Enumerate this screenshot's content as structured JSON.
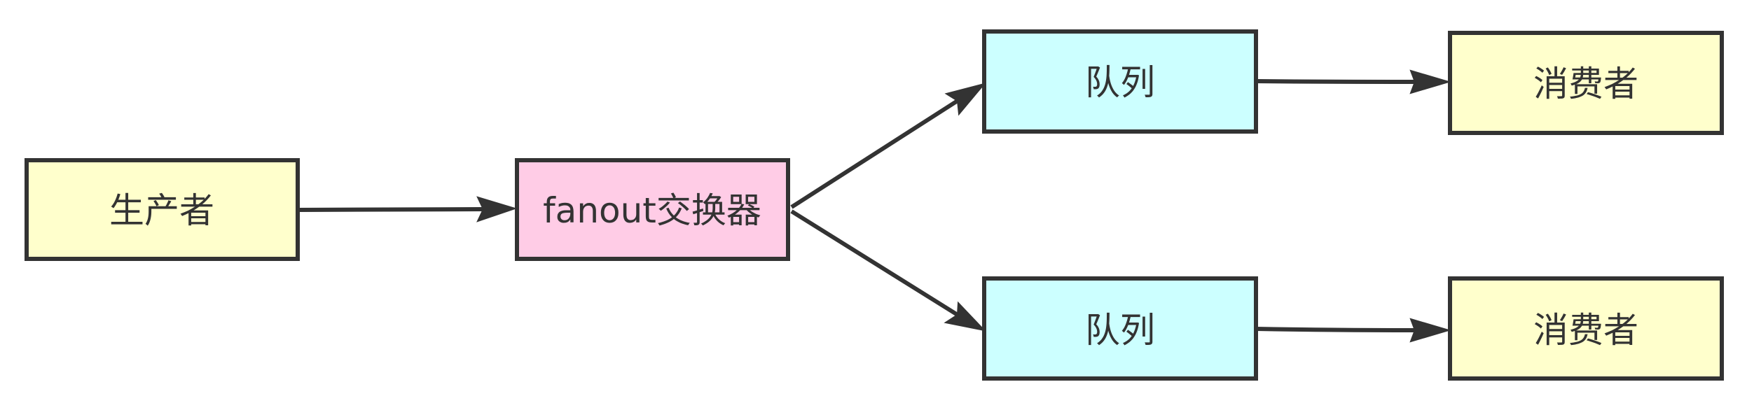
{
  "diagram": {
    "nodes": {
      "producer": {
        "label": "生产者",
        "fill": "#ffffcc"
      },
      "exchange": {
        "label": "fanout交换器",
        "fill": "#ffcce6"
      },
      "queue_top": {
        "label": "队列",
        "fill": "#ccffff"
      },
      "queue_bottom": {
        "label": "队列",
        "fill": "#ccffff"
      },
      "consumer_top": {
        "label": "消费者",
        "fill": "#ffffcc"
      },
      "consumer_bottom": {
        "label": "消费者",
        "fill": "#ffffcc"
      }
    },
    "edges": [
      {
        "from": "producer",
        "to": "exchange"
      },
      {
        "from": "exchange",
        "to": "queue_top"
      },
      {
        "from": "exchange",
        "to": "queue_bottom"
      },
      {
        "from": "queue_top",
        "to": "consumer_top"
      },
      {
        "from": "queue_bottom",
        "to": "consumer_bottom"
      }
    ],
    "colors": {
      "stroke": "#333333",
      "text": "#333333"
    }
  }
}
